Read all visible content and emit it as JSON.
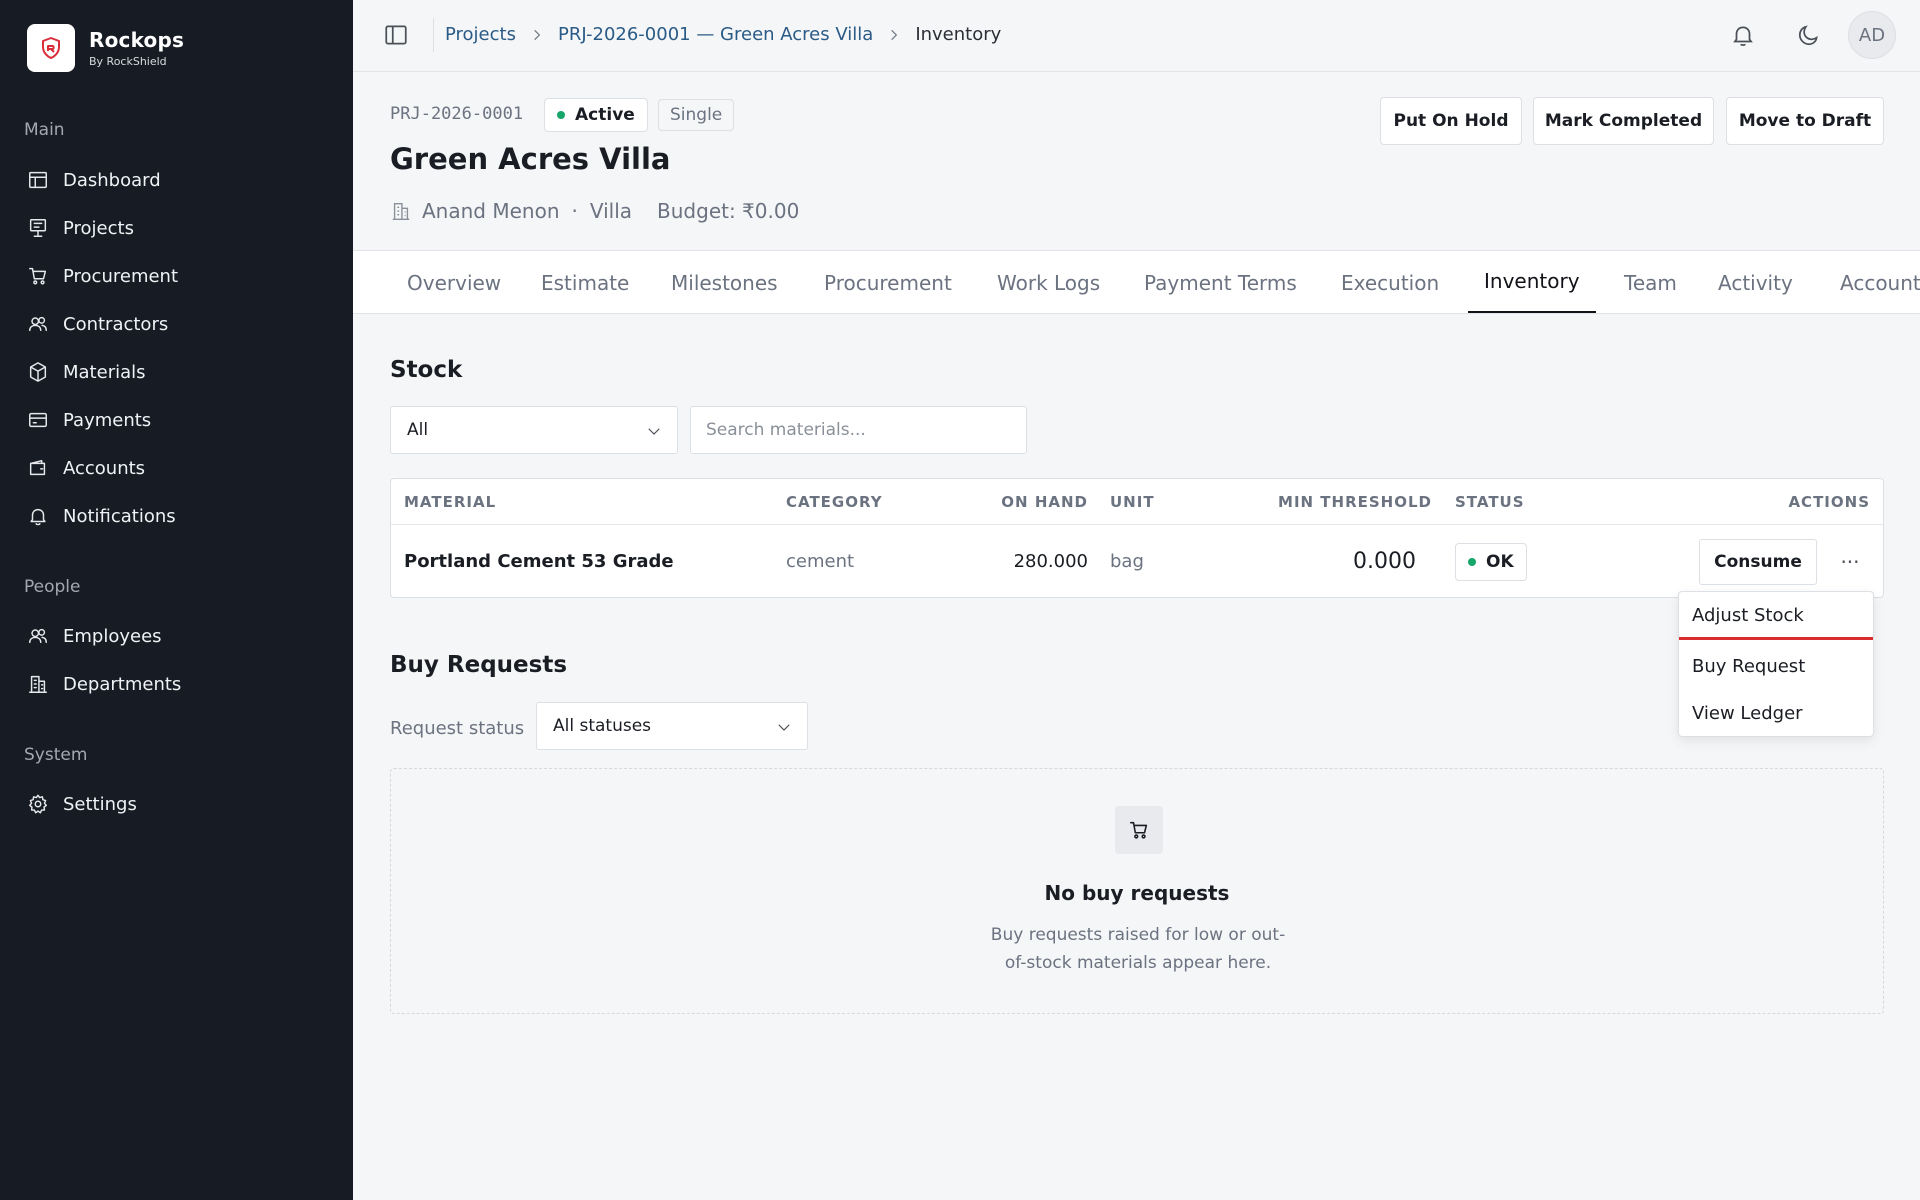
{
  "brand": {
    "name": "Rockops",
    "sub": "By RockShield"
  },
  "sidebar": {
    "sections": [
      {
        "label": "Main"
      },
      {
        "label": "People"
      },
      {
        "label": "System"
      }
    ],
    "items": [
      {
        "label": "Dashboard",
        "icon": "dashboard-icon"
      },
      {
        "label": "Projects",
        "icon": "projects-icon"
      },
      {
        "label": "Procurement",
        "icon": "cart-icon"
      },
      {
        "label": "Contractors",
        "icon": "users-icon"
      },
      {
        "label": "Materials",
        "icon": "cube-icon"
      },
      {
        "label": "Payments",
        "icon": "card-icon"
      },
      {
        "label": "Accounts",
        "icon": "wallet-icon"
      },
      {
        "label": "Notifications",
        "icon": "bell-icon"
      },
      {
        "label": "Employees",
        "icon": "users-icon"
      },
      {
        "label": "Departments",
        "icon": "building-icon"
      },
      {
        "label": "Settings",
        "icon": "gear-icon"
      }
    ]
  },
  "topbar": {
    "breadcrumbs": [
      "Projects",
      "PRJ-2026-0001 — Green Acres Villa",
      "Inventory"
    ],
    "avatar": "AD"
  },
  "project": {
    "code": "PRJ-2026-0001",
    "status": "Active",
    "type": "Single",
    "title": "Green Acres Villa",
    "client": "Anand Menon",
    "sep": "·",
    "category": "Villa",
    "budget": "Budget: ₹0.00",
    "actions": [
      "Put On Hold",
      "Mark Completed",
      "Move to Draft"
    ]
  },
  "tabs": [
    "Overview",
    "Estimate",
    "Milestones",
    "Procurement",
    "Work Logs",
    "Payment Terms",
    "Execution",
    "Inventory",
    "Team",
    "Activity",
    "Accounts"
  ],
  "stock": {
    "title": "Stock",
    "filter_value": "All",
    "search_placeholder": "Search materials...",
    "columns": [
      "MATERIAL",
      "CATEGORY",
      "ON HAND",
      "UNIT",
      "MIN THRESHOLD",
      "STATUS",
      "ACTIONS"
    ],
    "rows": [
      {
        "material": "Portland Cement 53 Grade",
        "category": "cement",
        "on_hand": "280.000",
        "unit": "bag",
        "min_threshold": "0.000",
        "status": "OK",
        "action": "Consume"
      }
    ],
    "more_label": "···",
    "menu": [
      "Adjust Stock",
      "Buy Request",
      "View Ledger"
    ]
  },
  "buy_requests": {
    "title": "Buy Requests",
    "filter_label": "Request status",
    "filter_value": "All statuses",
    "empty_title": "No buy requests",
    "empty_desc": "Buy requests raised for low or out-of-stock materials appear here."
  },
  "colors": {
    "sidebar_bg": "#161b24",
    "status_green": "#16a56a",
    "link_blue": "#2a5a86",
    "focus_red": "#d92d2d"
  }
}
